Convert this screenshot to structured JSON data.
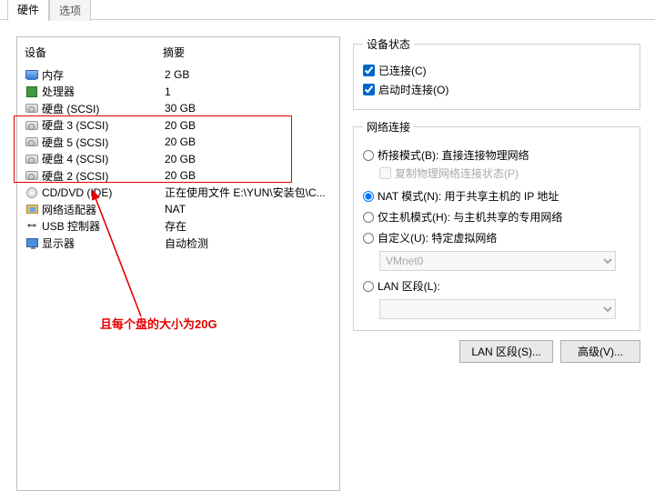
{
  "tabs": {
    "hardware": "硬件",
    "options": "选项"
  },
  "cols": {
    "device": "设备",
    "summary": "摘要"
  },
  "devices": [
    {
      "icon": "mem",
      "name": "内存",
      "summary": "2 GB"
    },
    {
      "icon": "cpu",
      "name": "处理器",
      "summary": "1"
    },
    {
      "icon": "hdd",
      "name": "硬盘 (SCSI)",
      "summary": "30 GB"
    },
    {
      "icon": "hdd",
      "name": "硬盘 3 (SCSI)",
      "summary": "20 GB"
    },
    {
      "icon": "hdd",
      "name": "硬盘 5 (SCSI)",
      "summary": "20 GB"
    },
    {
      "icon": "hdd",
      "name": "硬盘 4 (SCSI)",
      "summary": "20 GB"
    },
    {
      "icon": "hdd",
      "name": "硬盘 2 (SCSI)",
      "summary": "20 GB"
    },
    {
      "icon": "cd",
      "name": "CD/DVD (IDE)",
      "summary": "正在使用文件 E:\\YUN\\安装包\\C..."
    },
    {
      "icon": "net",
      "name": "网络适配器",
      "summary": "NAT"
    },
    {
      "icon": "usb",
      "name": "USB 控制器",
      "summary": "存在"
    },
    {
      "icon": "mon",
      "name": "显示器",
      "summary": "自动检测"
    }
  ],
  "annotation": "且每个盘的大小为20G",
  "right": {
    "status": {
      "legend": "设备状态",
      "connected": "已连接(C)",
      "connectOnStart": "启动时连接(O)"
    },
    "net": {
      "legend": "网络连接",
      "bridge": "桥接模式(B): 直接连接物理网络",
      "bridgeSub": "复制物理网络连接状态(P)",
      "nat": "NAT 模式(N): 用于共享主机的 IP 地址",
      "hostOnly": "仅主机模式(H): 与主机共享的专用网络",
      "custom": "自定义(U): 特定虚拟网络",
      "customVal": "VMnet0",
      "lan": "LAN 区段(L):",
      "lanVal": ""
    },
    "buttons": {
      "lanseg": "LAN 区段(S)...",
      "advanced": "高级(V)..."
    }
  }
}
